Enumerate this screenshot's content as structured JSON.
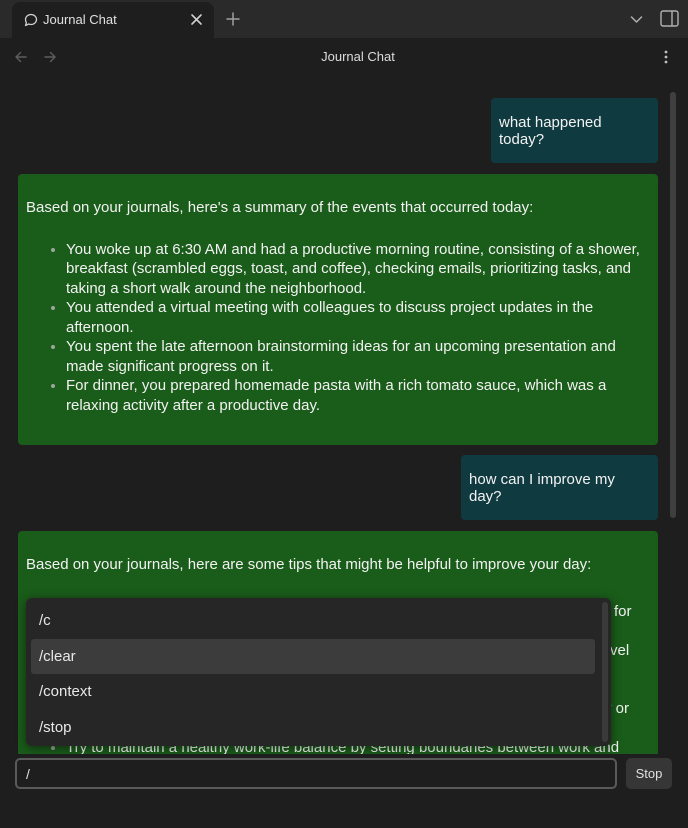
{
  "tab": {
    "title": "Journal Chat"
  },
  "header": {
    "title": "Journal Chat"
  },
  "messages": {
    "user1": "what happened today?",
    "bot1": {
      "intro": "Based on your journals, here's a summary of the events that occurred today:",
      "items": [
        "You woke up at 6:30 AM and had a productive morning routine, consisting of a shower, breakfast (scrambled eggs, toast, and coffee), checking emails, prioritizing tasks, and taking a short walk around the neighborhood.",
        "You attended a virtual meeting with colleagues to discuss project updates in the afternoon.",
        "You spent the late afternoon brainstorming ideas for an upcoming presentation and made significant progress on it.",
        "For dinner, you prepared homemade pasta with a rich tomato sauce, which was a relaxing activity after a productive day."
      ]
    },
    "user2": "how can I improve my day?",
    "bot2": {
      "intro": "Based on your journals, here are some tips that might be helpful to improve your day:",
      "fragments": [
        "for",
        "vel",
        "y or"
      ],
      "last_item": "Try to maintain a healthy work-life balance by setting boundaries between work and"
    }
  },
  "suggestions": {
    "items": [
      "/c",
      "/clear",
      "/context",
      "/stop"
    ],
    "selected_index": 1
  },
  "input": {
    "value": "/"
  },
  "stop_button": {
    "label": "Stop"
  },
  "colors": {
    "user_bubble": "#0f3a40",
    "bot_bubble": "#1a5c1a",
    "background": "#1e1e1e"
  }
}
